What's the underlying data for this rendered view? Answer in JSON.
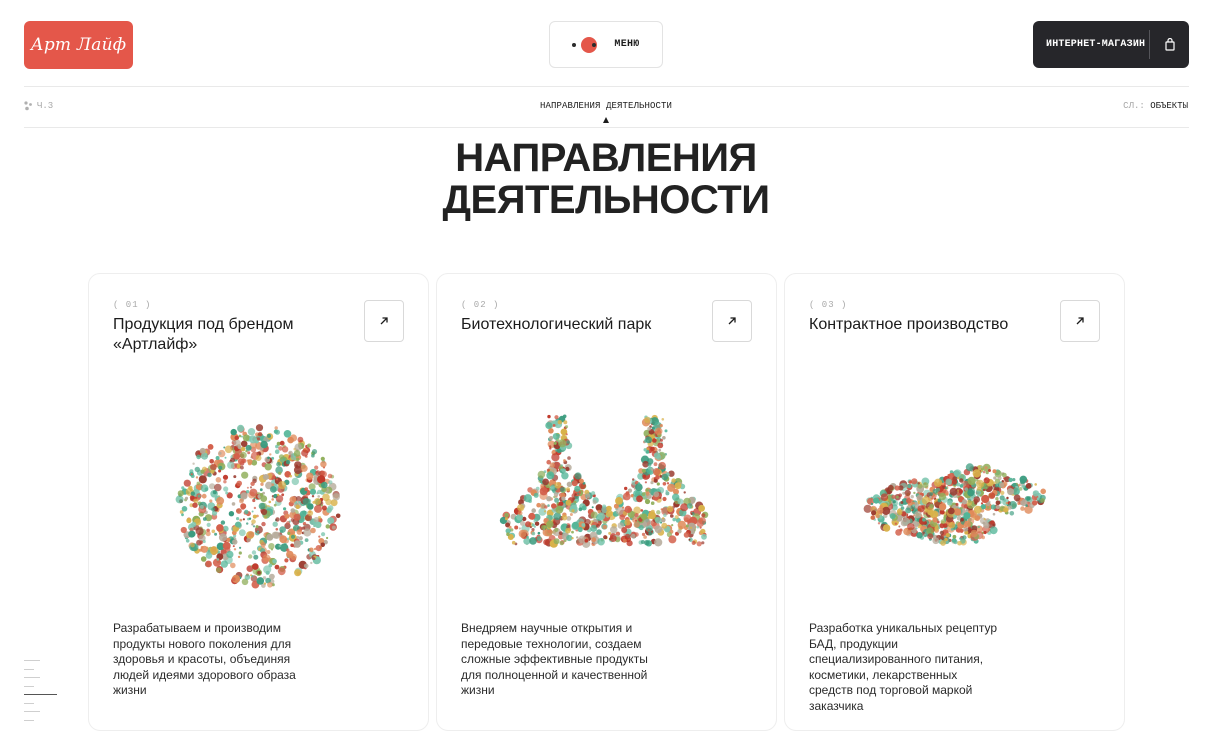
{
  "header": {
    "logo_text": "Арт Лайф",
    "menu_label": "МЕНЮ",
    "shop_label": "ИНТЕРНЕТ-МАГАЗИН",
    "shop_icon": "shopping-bag-icon"
  },
  "breadcrumb": {
    "part_label": "Ч.3",
    "current": "НАПРАВЛЕНИЯ ДЕЯТЕЛЬНОСТИ",
    "next_prefix": "СЛ.:",
    "next_label": "ОБЪЕКТЫ"
  },
  "page_title": "НАПРАВЛЕНИЯ ДЕЯТЕЛЬНОСТИ",
  "cards": [
    {
      "number": "( 01 )",
      "title": "Продукция под брендом «Артлайф»",
      "description": "Разрабатываем и производим продукты нового поколения для здоровья и красоты, объединяя людей идеями здорового образа жизни",
      "illustration": "sliced-circle-dots"
    },
    {
      "number": "( 02 )",
      "title": "Биотехнологический парк",
      "description": "Внедряем научные открытия и передовые технологии, создаем сложные эффективные продукты для полноценной и качественной жизни",
      "illustration": "lab-flasks-dots"
    },
    {
      "number": "( 03 )",
      "title": "Контрактное производство",
      "description": "Разработка уникальных рецептур БАД, продукции специализированного питания, косметики, лекарственных средств под торговой маркой заказчика",
      "illustration": "cloud-shape-dots"
    }
  ],
  "colors": {
    "brand_red": "#e4574a",
    "dark": "#26262a",
    "dot_palette": [
      "#c0392b",
      "#d35f4a",
      "#e08a5a",
      "#d9b24a",
      "#8fae5a",
      "#3a9b7e",
      "#52b597",
      "#7fc7b0",
      "#b5aa9a",
      "#9a3a2e"
    ]
  }
}
